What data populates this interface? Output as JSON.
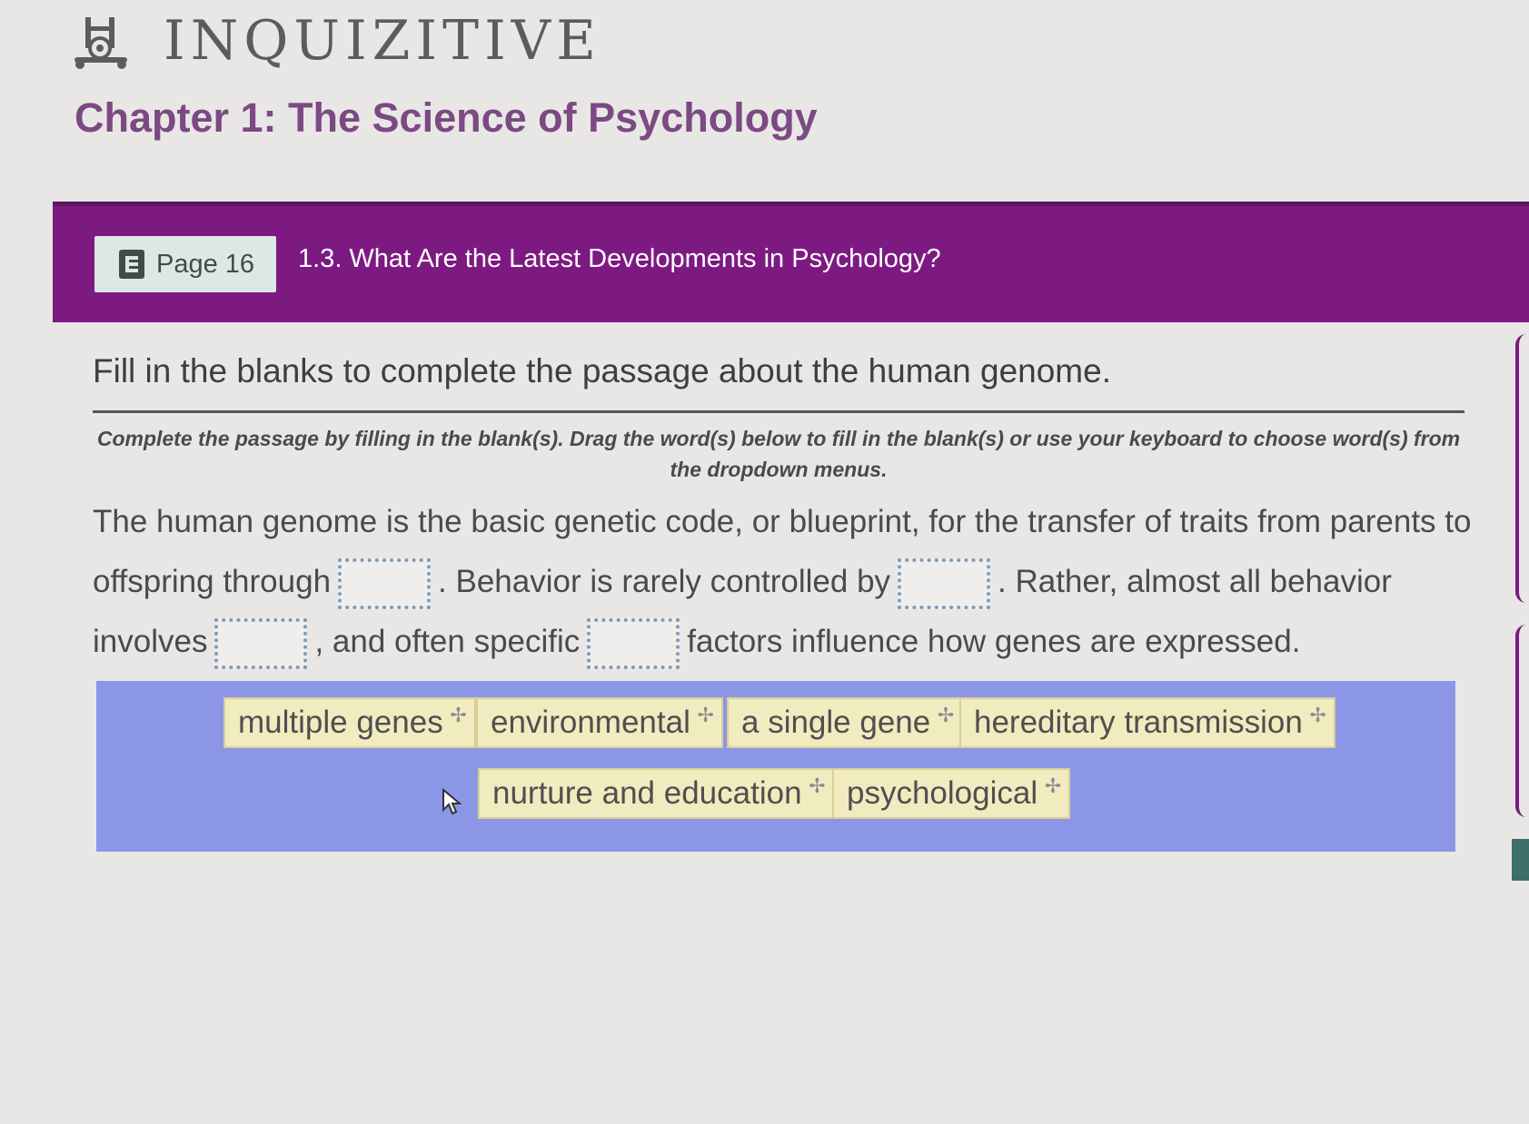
{
  "app": {
    "logo_text": "INQUIZITIVE",
    "chapter_title": "Chapter 1: The Science of Psychology"
  },
  "banner": {
    "page_label": "Page 16",
    "section_title": "1.3. What Are the Latest Developments in Psychology?",
    "color": "#7d1a82"
  },
  "question": {
    "prompt": "Fill in the blanks to complete the passage about the human genome.",
    "instructions": "Complete the passage by filling in the blank(s). Drag the word(s) below to fill in the blank(s) or use your keyboard to choose word(s) from the dropdown menus."
  },
  "passage": {
    "seg1": "The human genome is the basic genetic code, or blueprint, for the transfer of traits from parents to offspring through",
    "seg2": ". Behavior is rarely controlled by",
    "seg3": ". Rather, almost all behavior involves",
    "seg4": ", and often specific",
    "seg5": "factors influence how genes are expressed."
  },
  "word_bank": {
    "background": "#8b97e6",
    "chips": [
      "multiple genes",
      "environmental",
      "a single gene",
      "hereditary transmission",
      "nurture and education",
      "psychological"
    ]
  }
}
